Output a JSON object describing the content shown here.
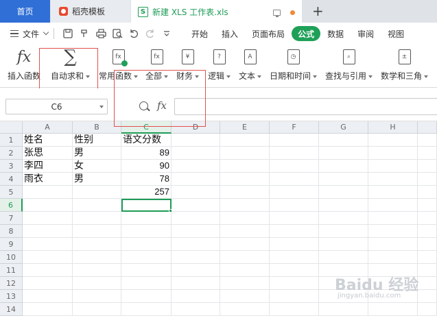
{
  "tabs": {
    "home": "首页",
    "template": "稻壳模板",
    "document": "新建 XLS 工作表.xls"
  },
  "menu": {
    "file": "文件",
    "items": [
      "开始",
      "插入",
      "页面布局",
      "公式",
      "数据",
      "审阅",
      "视图"
    ],
    "active": "公式"
  },
  "ribbon": {
    "insert_function": "插入函数",
    "autosum": "自动求和",
    "common": "常用函数",
    "all": "全部",
    "finance": "财务",
    "logic": "逻辑",
    "text": "文本",
    "datetime": "日期和时间",
    "lookup": "查找与引用",
    "math": "数学和三角"
  },
  "formula_bar": {
    "name_box": "C6",
    "fx": "fx",
    "formula": ""
  },
  "grid": {
    "columns": [
      "A",
      "B",
      "C",
      "D",
      "E",
      "F",
      "G",
      "H"
    ],
    "rows": [
      "1",
      "2",
      "3",
      "4",
      "5",
      "6",
      "7",
      "8",
      "9",
      "10",
      "11",
      "12",
      "13",
      "14"
    ],
    "active_cell": "C6",
    "cells": {
      "A1": "姓名",
      "B1": "性别",
      "C1": "语文分数",
      "A2": "张思",
      "B2": "男",
      "C2": "89",
      "A3": "李四",
      "B3": "女",
      "C3": "90",
      "A4": "雨衣",
      "B4": "男",
      "C4": "78",
      "C5": "257"
    }
  },
  "watermark": {
    "brand": "Baidu 经验",
    "url": "jingyan.baidu.com"
  },
  "colors": {
    "accent": "#1fa058",
    "home_tab": "#2f6fd6",
    "annotation": "#e0504f"
  }
}
